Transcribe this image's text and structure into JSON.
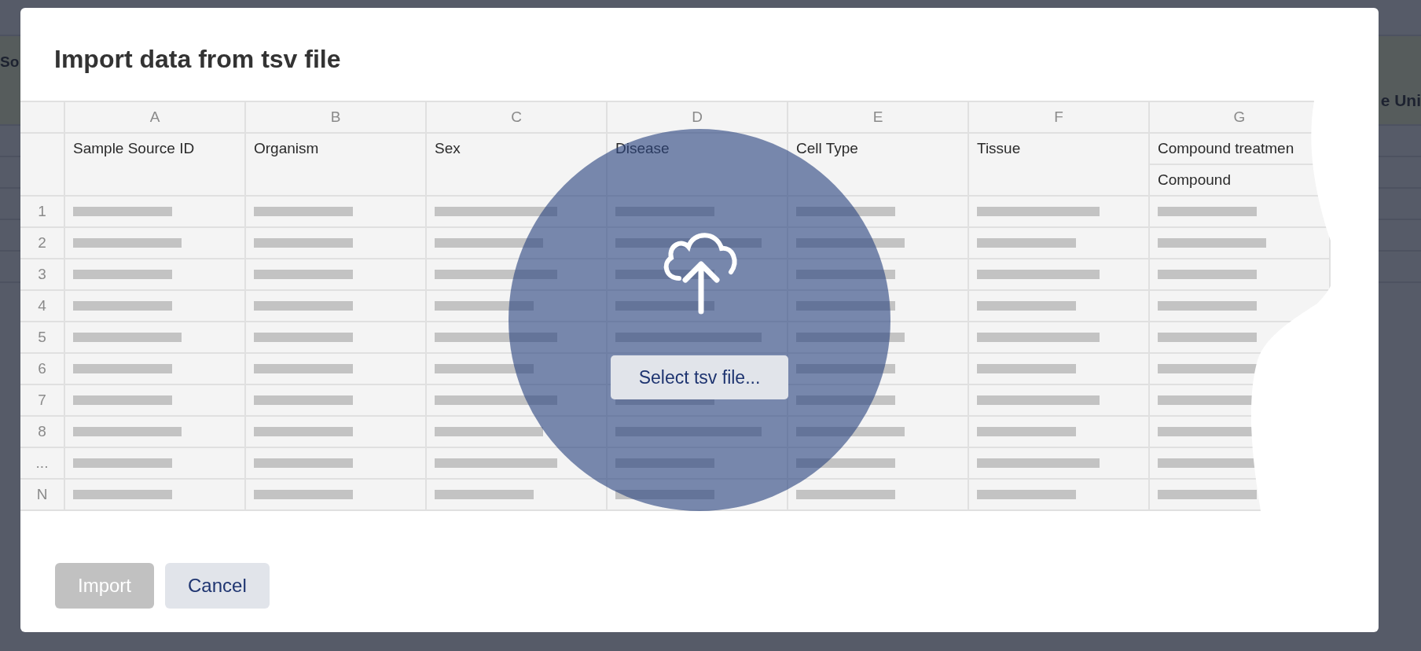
{
  "background": {
    "texts": [
      "So",
      "e Uni"
    ]
  },
  "dialog": {
    "title": "Import data from tsv file",
    "table": {
      "column_letters": [
        "A",
        "B",
        "C",
        "D",
        "E",
        "F",
        "G"
      ],
      "headers": [
        {
          "label": "Sample Source ID"
        },
        {
          "label": "Organism"
        },
        {
          "label": "Sex"
        },
        {
          "label": "Disease"
        },
        {
          "label": "Cell Type"
        },
        {
          "label": "Tissue"
        },
        {
          "label": "Compound treatmen",
          "sub": "Compound"
        }
      ],
      "rows": [
        "1",
        "2",
        "3",
        "4",
        "5",
        "6",
        "7",
        "8",
        "...",
        "N"
      ]
    },
    "upload": {
      "button": "Select tsv file..."
    },
    "buttons": [
      {
        "label": "Import",
        "disabled": true
      },
      {
        "label": "Cancel",
        "disabled": false
      }
    ]
  }
}
